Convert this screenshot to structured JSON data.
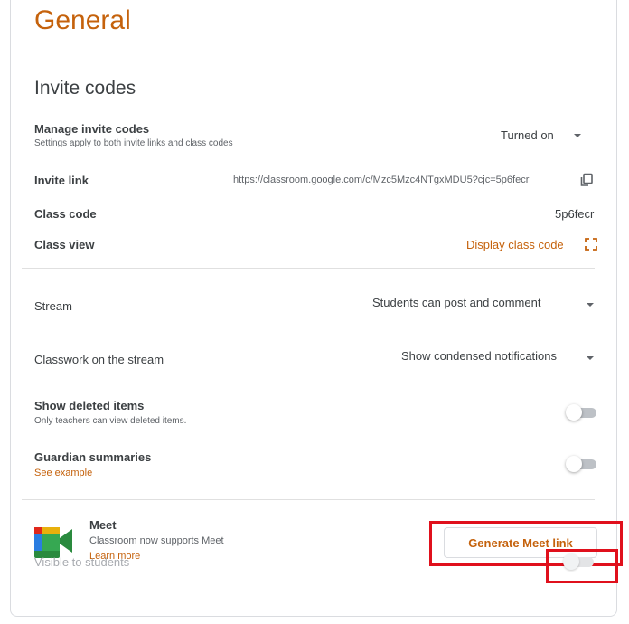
{
  "section_title": "General",
  "invite_codes": {
    "heading": "Invite codes",
    "manage": {
      "label": "Manage invite codes",
      "description": "Settings apply to both invite links and class codes",
      "value": "Turned on"
    },
    "invite_link": {
      "label": "Invite link",
      "value": "https://classroom.google.com/c/Mzc5Mzc4NTgxMDU5?cjc=5p6fecr",
      "icon": "copy-icon"
    },
    "class_code": {
      "label": "Class code",
      "value": "5p6fecr"
    },
    "class_view": {
      "label": "Class view",
      "action": "Display class code",
      "icon": "fullscreen-icon"
    }
  },
  "stream": {
    "label": "Stream",
    "value": "Students can post and comment"
  },
  "classwork": {
    "label": "Classwork on the stream",
    "value": "Show condensed notifications"
  },
  "deleted_items": {
    "label": "Show deleted items",
    "description": "Only teachers can view deleted items.",
    "enabled": false
  },
  "guardian": {
    "label": "Guardian summaries",
    "link": "See example",
    "enabled": false
  },
  "meet": {
    "title": "Meet",
    "description": "Classroom now supports Meet",
    "learn_more": "Learn more",
    "button": "Generate Meet link",
    "visible_label": "Visible to students",
    "visible": false,
    "icon": "google-meet-logo"
  },
  "colors": {
    "accent": "#c5620c",
    "highlight_box": "#e0101c"
  }
}
